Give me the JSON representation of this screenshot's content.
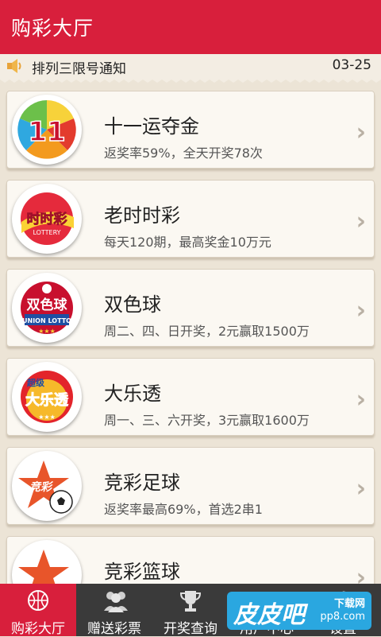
{
  "header": {
    "title": "购彩大厅"
  },
  "notice": {
    "icon": "speaker-icon",
    "text": "排列三限号通知",
    "date": "03-25"
  },
  "lotteries": [
    {
      "name": "十一运夺金",
      "desc": "返奖率59%，全天开奖78次",
      "logo_text": "11"
    },
    {
      "name": "老时时彩",
      "desc": "每天120期，最高奖金10万元",
      "logo_text": "时时彩",
      "logo_sub": "LOTTERY"
    },
    {
      "name": "双色球",
      "desc": "周二、四、日开奖，2元赢取1500万",
      "logo_text": "双色球",
      "logo_sub": "UNION LOTTO"
    },
    {
      "name": "大乐透",
      "desc": "周一、三、六开奖，3元赢取1600万",
      "logo_text": "大乐透",
      "logo_sub": "超级"
    },
    {
      "name": "竞彩足球",
      "desc": "返奖率最高69%，首选2串1",
      "logo_text": "竞彩"
    },
    {
      "name": "竞彩篮球",
      "desc": "",
      "logo_text": ""
    }
  ],
  "tabs": [
    {
      "label": "购彩大厅",
      "icon": "basketball-icon"
    },
    {
      "label": "赠送彩票",
      "icon": "people-icon"
    },
    {
      "label": "开奖查询",
      "icon": "trophy-icon"
    },
    {
      "label": "用户中心",
      "icon": "user-icon"
    },
    {
      "label": "设置",
      "icon": "gear-icon"
    }
  ],
  "watermark": {
    "big": "皮皮吧",
    "small1": "下载网",
    "small2": "pp8.com"
  },
  "colors": {
    "brand_red": "#d81f3c",
    "tabbar": "#3a3a3a",
    "background": "#ece4d6"
  }
}
